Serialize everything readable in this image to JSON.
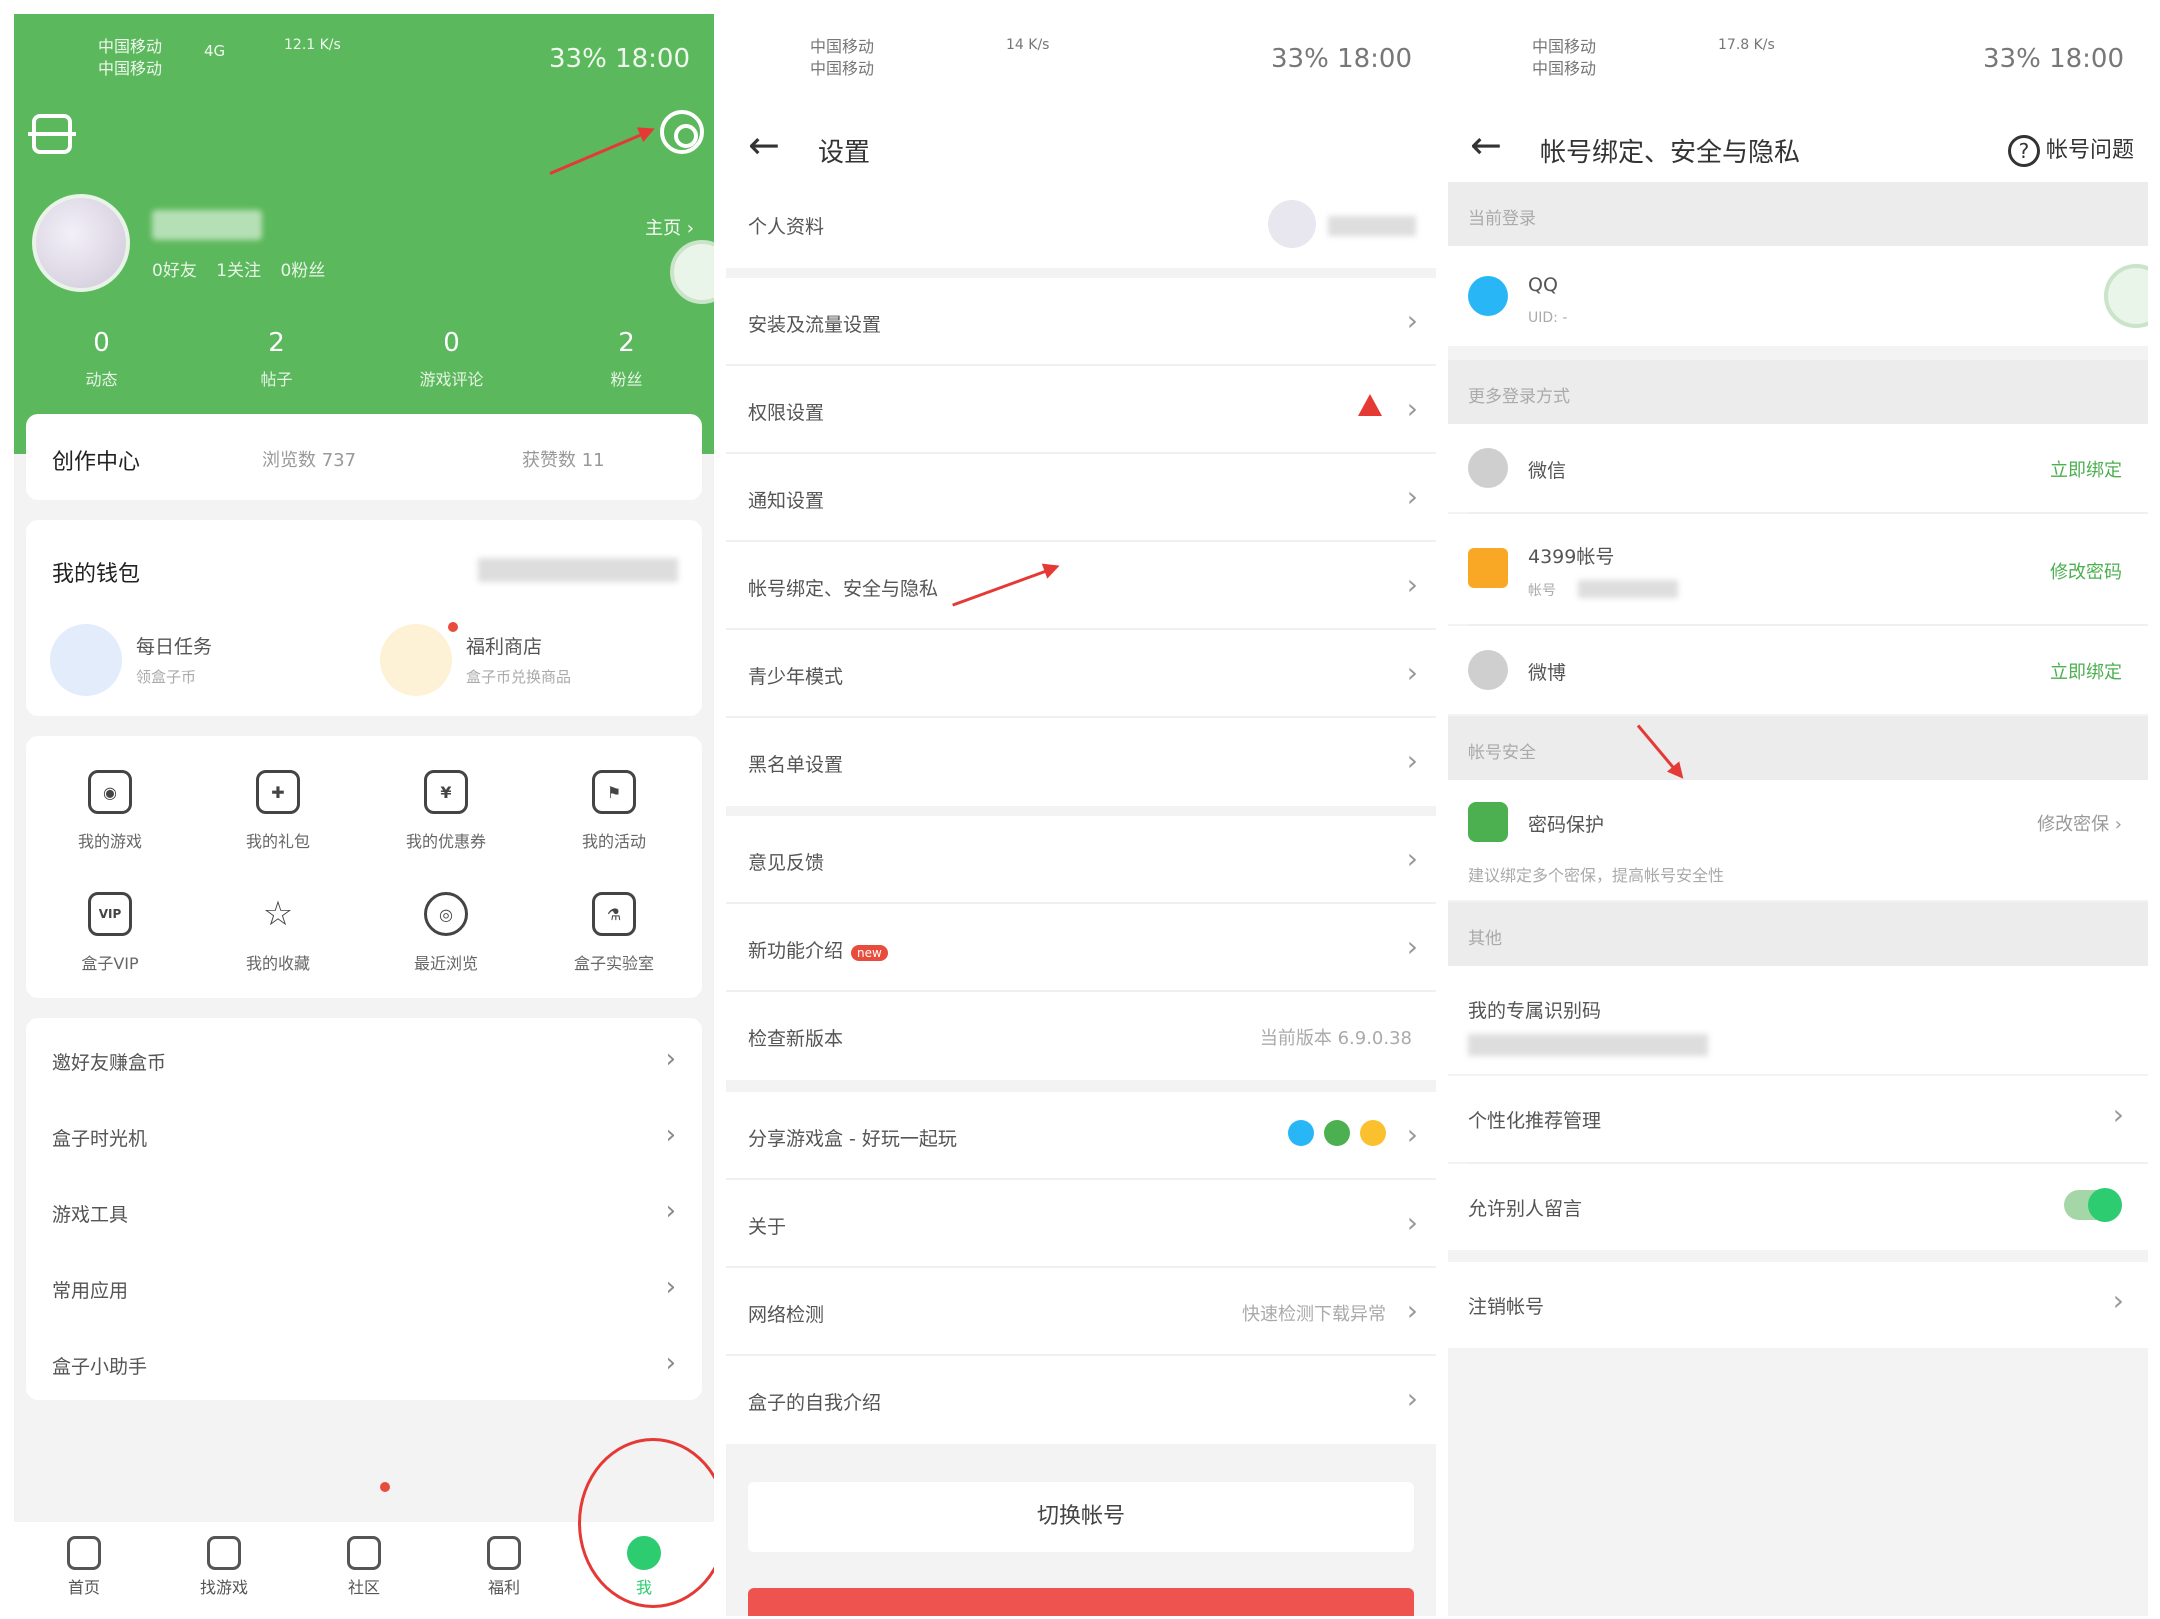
{
  "status_bar": {
    "carrier_1": "中国移动",
    "carrier_2": "中国移动",
    "net_p1": "4G",
    "speed_p1": "12.1 K/s",
    "speed_p2": "14 K/s",
    "speed_p3": "17.8 K/s",
    "right": "33% 18:00"
  },
  "profile": {
    "meta": "0好友 1关注 0粉丝",
    "homepage_link": "主页 ›",
    "stats": [
      {
        "value": "0",
        "label": "动态"
      },
      {
        "value": "2",
        "label": "帖子"
      },
      {
        "value": "0",
        "label": "游戏评论"
      },
      {
        "value": "2",
        "label": "粉丝"
      }
    ]
  },
  "creator": {
    "title": "创作中心",
    "views": "浏览数 737",
    "likes": "获赞数 11"
  },
  "wallet": {
    "title": "我的钱包",
    "items": [
      {
        "title": "每日任务",
        "sub": "领盒子币"
      },
      {
        "title": "福利商店",
        "sub": "盒子币兑换商品"
      }
    ]
  },
  "grid_items": [
    {
      "label": "我的游戏",
      "icon": "gamepad-icon"
    },
    {
      "label": "我的礼包",
      "icon": "gift-icon"
    },
    {
      "label": "我的优惠券",
      "icon": "coupon-icon"
    },
    {
      "label": "我的活动",
      "icon": "flag-icon"
    },
    {
      "label": "盒子VIP",
      "icon": "vip-icon"
    },
    {
      "label": "我的收藏",
      "icon": "star-icon"
    },
    {
      "label": "最近浏览",
      "icon": "eye-icon"
    },
    {
      "label": "盒子实验室",
      "icon": "flask-icon"
    }
  ],
  "menu_list": [
    "邀好友赚盒币",
    "盒子时光机",
    "游戏工具",
    "常用应用",
    "盒子小助手"
  ],
  "tabbar": [
    {
      "label": "首页",
      "icon": "home-icon"
    },
    {
      "label": "找游戏",
      "icon": "game-search-icon"
    },
    {
      "label": "社区",
      "icon": "community-icon"
    },
    {
      "label": "福利",
      "icon": "welfare-icon"
    },
    {
      "label": "我",
      "icon": "me-icon"
    }
  ],
  "settings": {
    "title": "设置",
    "rows": [
      {
        "label": "个人资料",
        "right": ""
      },
      {
        "label": "安装及流量设置",
        "right": ""
      },
      {
        "label": "权限设置",
        "right": ""
      },
      {
        "label": "通知设置",
        "right": ""
      },
      {
        "label": "帐号绑定、安全与隐私",
        "right": ""
      },
      {
        "label": "青少年模式",
        "right": ""
      },
      {
        "label": "黑名单设置",
        "right": ""
      },
      {
        "label": "意见反馈",
        "right": ""
      },
      {
        "label": "新功能介绍",
        "right": ""
      },
      {
        "label": "检查新版本",
        "right": "当前版本 6.9.0.38"
      },
      {
        "label": "分享游戏盒 - 好玩一起玩",
        "right": ""
      },
      {
        "label": "关于",
        "right": ""
      },
      {
        "label": "网络检测",
        "right": "快速检测下载异常"
      },
      {
        "label": "盒子的自我介绍",
        "right": ""
      }
    ],
    "new_badge": "new",
    "switch_account": "切换帐号"
  },
  "account": {
    "title": "帐号绑定、安全与隐私",
    "help": "帐号问题",
    "current_login": "当前登录",
    "qq_label": "QQ",
    "qq_sub": "UID: -",
    "more_login": "更多登录方式",
    "wechat": "微信",
    "bind_now": "立即绑定",
    "account_4399": "4399帐号",
    "account_4399_sub": "帐号",
    "change_password": "修改密码",
    "weibo": "微博",
    "security_head": "帐号安全",
    "password_protect": "密码保护",
    "password_protect_action": "修改密保 ›",
    "security_tip": "建议绑定多个密保，提高帐号安全性",
    "other_head": "其他",
    "my_id_code": "我的专属识别码",
    "personalized": "个性化推荐管理",
    "allow_messages": "允许别人留言",
    "cancel_account": "注销帐号"
  },
  "colors": {
    "brand_green": "#5cb85c",
    "accent_green": "#4caf50",
    "warning_red": "#e53935"
  }
}
